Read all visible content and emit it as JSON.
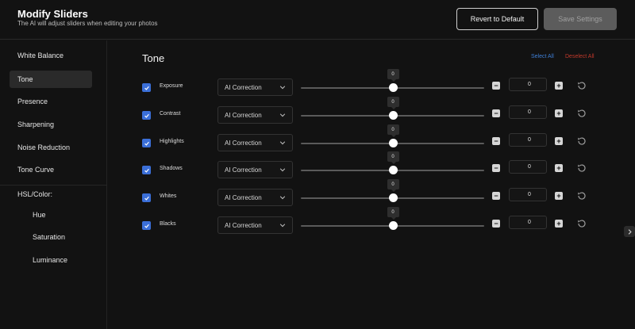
{
  "header": {
    "title": "Modify Sliders",
    "subtitle": "The AI will adjust sliders when editing your photos",
    "revert_label": "Revert to Default",
    "save_label": "Save Settings"
  },
  "sidebar": {
    "items": [
      {
        "label": "White Balance",
        "active": false
      },
      {
        "label": "Tone",
        "active": true
      },
      {
        "label": "Presence",
        "active": false
      },
      {
        "label": "Sharpening",
        "active": false
      },
      {
        "label": "Noise Reduction",
        "active": false
      },
      {
        "label": "Tone Curve",
        "active": false
      }
    ],
    "hsl_heading": "HSL/Color:",
    "hsl_items": [
      {
        "label": "Hue"
      },
      {
        "label": "Saturation"
      },
      {
        "label": "Luminance"
      }
    ]
  },
  "main": {
    "section_title": "Tone",
    "select_all": "Select All",
    "deselect_all": "Deselect All",
    "rows": [
      {
        "label": "Exposure",
        "checked": true,
        "mode": "AI Correction",
        "slider_value": "0",
        "slider_fraction": 0.5,
        "input_value": "0"
      },
      {
        "label": "Contrast",
        "checked": true,
        "mode": "AI Correction",
        "slider_value": "0",
        "slider_fraction": 0.5,
        "input_value": "0"
      },
      {
        "label": "Highlights",
        "checked": true,
        "mode": "AI Correction",
        "slider_value": "0",
        "slider_fraction": 0.5,
        "input_value": "0"
      },
      {
        "label": "Shadows",
        "checked": true,
        "mode": "AI Correction",
        "slider_value": "0",
        "slider_fraction": 0.5,
        "input_value": "0"
      },
      {
        "label": "Whites",
        "checked": true,
        "mode": "AI Correction",
        "slider_value": "0",
        "slider_fraction": 0.5,
        "input_value": "0"
      },
      {
        "label": "Blacks",
        "checked": true,
        "mode": "AI Correction",
        "slider_value": "0",
        "slider_fraction": 0.5,
        "input_value": "0"
      }
    ]
  },
  "colors": {
    "accent": "#3b6fd8",
    "select_all": "#3f7fd6",
    "deselect_all": "#c0392b",
    "background": "#121212"
  },
  "icons": {
    "checkbox": "check-icon",
    "dropdown": "chevron-down-icon",
    "reset": "reset-icon",
    "expand": "chevron-right-icon"
  }
}
